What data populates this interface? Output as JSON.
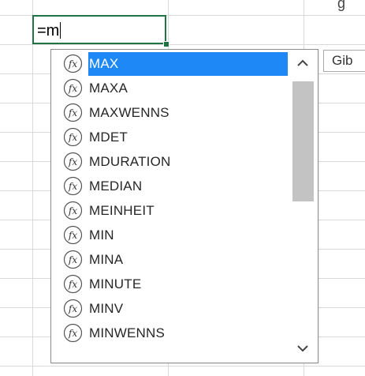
{
  "cell": {
    "formula_text": "=m"
  },
  "column_header_fragment": "g",
  "tooltip": {
    "text": "Gib"
  },
  "autocomplete": {
    "selected_index": 0,
    "icon": "function-fx-icon",
    "items": [
      {
        "label": "MAX"
      },
      {
        "label": "MAXA"
      },
      {
        "label": "MAXWENNS"
      },
      {
        "label": "MDET"
      },
      {
        "label": "MDURATION"
      },
      {
        "label": "MEDIAN"
      },
      {
        "label": "MEINHEIT"
      },
      {
        "label": "MIN"
      },
      {
        "label": "MINA"
      },
      {
        "label": "MINUTE"
      },
      {
        "label": "MINV"
      },
      {
        "label": "MINWENNS"
      }
    ]
  },
  "scrollbar": {
    "up_icon": "chevron-up-icon",
    "down_icon": "chevron-down-icon",
    "visible_fraction": 0.48,
    "position_fraction": 0.0
  },
  "colors": {
    "selection": "#1e88f7",
    "active_cell_border": "#217346",
    "grid": "#d9d9d9",
    "scroll_thumb": "#c3c3c3"
  }
}
